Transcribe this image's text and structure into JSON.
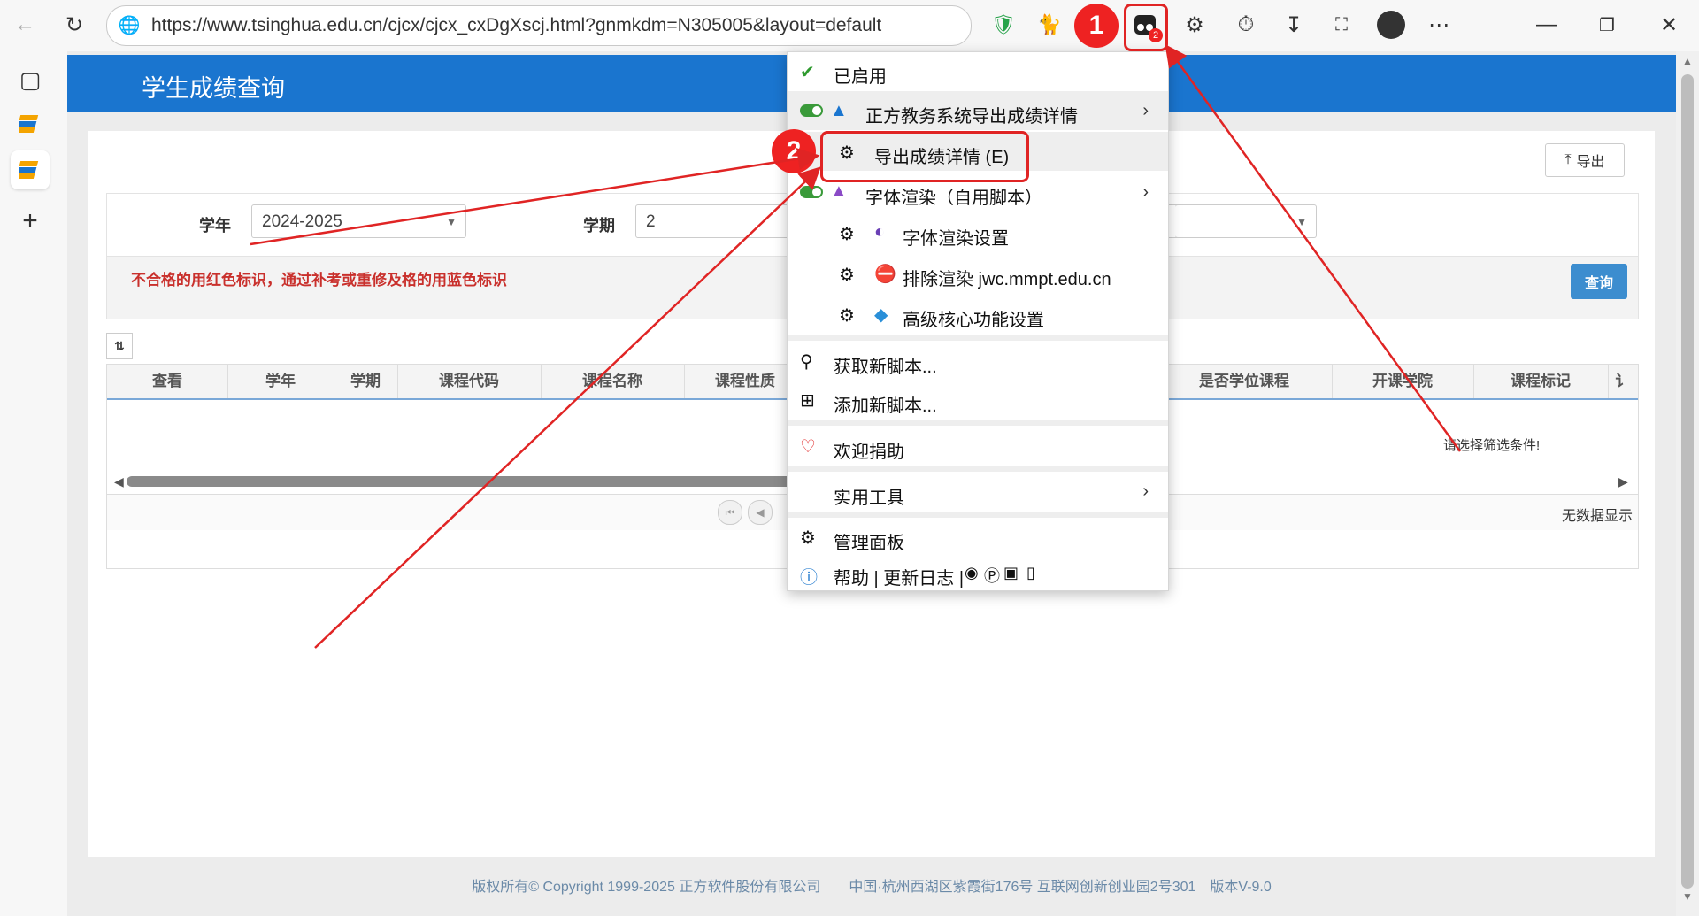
{
  "browser": {
    "url": "https://www.tsinghua.edu.cn/cjcx/cjcx_cxDgXscj.html?gnmkdm=N305005&layout=default",
    "toolbar_icons": [
      "back-icon",
      "refresh-icon",
      "shield-icon",
      "cat-extension-icon",
      "tampermonkey-icon",
      "extensions-icon",
      "history-icon",
      "download-icon",
      "screenshot-icon",
      "avatar",
      "more-icon",
      "minimize-icon",
      "restore-icon",
      "close-icon"
    ],
    "tampermonkey_badge": "2"
  },
  "sidebar": {
    "items": [
      "tab-actions-icon",
      "app-icon-1",
      "app-icon-2",
      "add-icon"
    ]
  },
  "page": {
    "header_title": "学生成绩查询",
    "export_label": "导出",
    "year_label": "学年",
    "year_value": "2024-2025",
    "term_label": "学期",
    "term_value": "2",
    "notice": "不合格的用红色标识，通过补考或重修及格的用蓝色标识",
    "query_label": "查询",
    "columns": [
      "查看",
      "学年",
      "学期",
      "课程代码",
      "课程名称",
      "课程性质",
      "是否学位课程",
      "开课学院",
      "课程标记",
      "讠"
    ],
    "empty_message": "请选择筛选条件!",
    "no_data": "无数据显示",
    "footer": "版权所有© Copyright 1999-2025 正方软件股份有限公司　　中国·杭州西湖区紫霞街176号 互联网创新创业园2号301　版本V-9.0"
  },
  "menu": {
    "enabled": "已启用",
    "script1": "正方教务系统导出成绩详情",
    "script1_cmd": "导出成绩详情 (E)",
    "script2": "字体渲染（自用脚本）",
    "script2_cmd1": "字体渲染设置",
    "script2_cmd2": "排除渲染 jwc.mmpt.edu.cn",
    "script2_cmd3": "高级核心功能设置",
    "get_scripts": "获取新脚本...",
    "add_script": "添加新脚本...",
    "donate": "欢迎捐助",
    "utilities": "实用工具",
    "dashboard": "管理面板",
    "help": "帮助 | 更新日志 |"
  },
  "annotations": {
    "step1": "1",
    "step2": "2",
    "color": "#e02424"
  }
}
